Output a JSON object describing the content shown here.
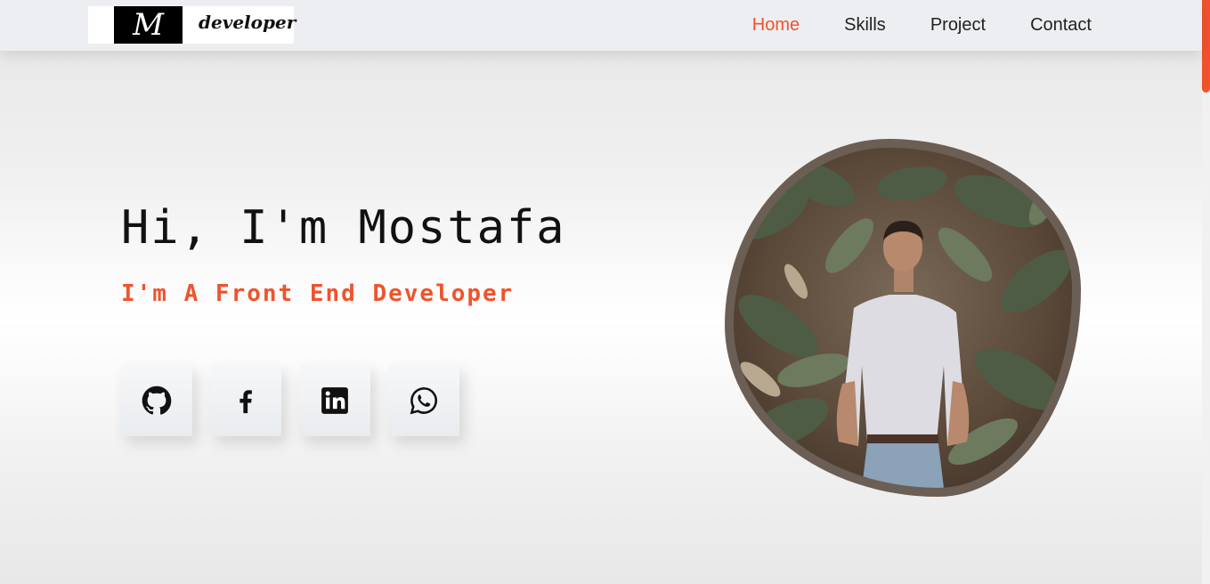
{
  "brand": {
    "mark": "M",
    "text": "developer"
  },
  "nav": {
    "items": [
      {
        "label": "Home",
        "active": true
      },
      {
        "label": "Skills",
        "active": false
      },
      {
        "label": "Project",
        "active": false
      },
      {
        "label": "Contact",
        "active": false
      }
    ]
  },
  "hero": {
    "title": "Hi, I'm Mostafa",
    "subtitle": "I'm A Front End Developer"
  },
  "socials": [
    {
      "icon": "github-icon"
    },
    {
      "icon": "facebook-icon"
    },
    {
      "icon": "linkedin-icon"
    },
    {
      "icon": "whatsapp-icon"
    }
  ],
  "theme": {
    "accent": "#f0532c",
    "navbar_bg": "#eceef1",
    "text": "#111111"
  }
}
